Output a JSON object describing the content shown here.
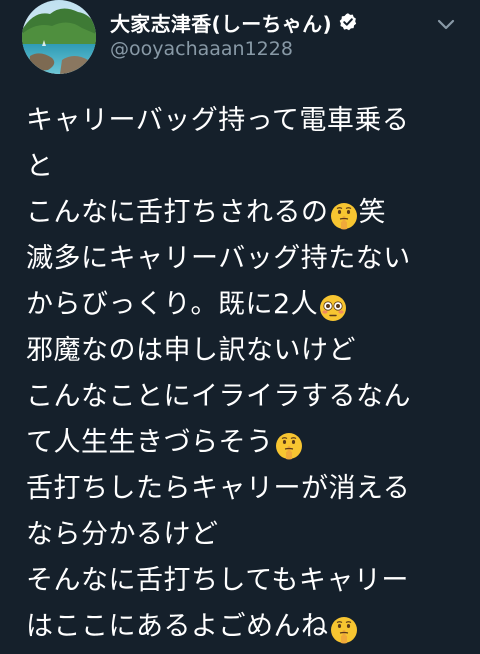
{
  "author": {
    "display_name": "大家志津香(しーちゃん)",
    "handle": "@ooyachaaan1228",
    "verified": true,
    "avatar_icon": "avatar-photo-icon"
  },
  "header": {
    "more_icon": "chevron-down-icon"
  },
  "tweet": {
    "lines": [
      {
        "text": "キャリーバッグ持って電車乗る"
      },
      {
        "text": "と"
      },
      {
        "text": "こんなに舌打ちされるの",
        "emoji": "shushing-face",
        "after": "笑"
      },
      {
        "text": "滅多にキャリーバッグ持たない"
      },
      {
        "text": "からびっくり。既に2人",
        "emoji": "flushed-face",
        "after": ""
      },
      {
        "text": "邪魔なのは申し訳ないけど"
      },
      {
        "text": "こんなことにイライラするなん"
      },
      {
        "text": "て人生生きづらそう",
        "emoji": "shushing-face",
        "after": ""
      },
      {
        "text": "舌打ちしたらキャリーが消える"
      },
      {
        "text": "なら分かるけど"
      },
      {
        "text": "そんなに舌打ちしてもキャリー"
      },
      {
        "text": "はここにあるよごめんね",
        "emoji": "shushing-face",
        "after": ""
      }
    ]
  },
  "colors": {
    "background": "#15202b",
    "text": "#ffffff",
    "secondary": "#8899a6",
    "verified": "#ffffff"
  }
}
